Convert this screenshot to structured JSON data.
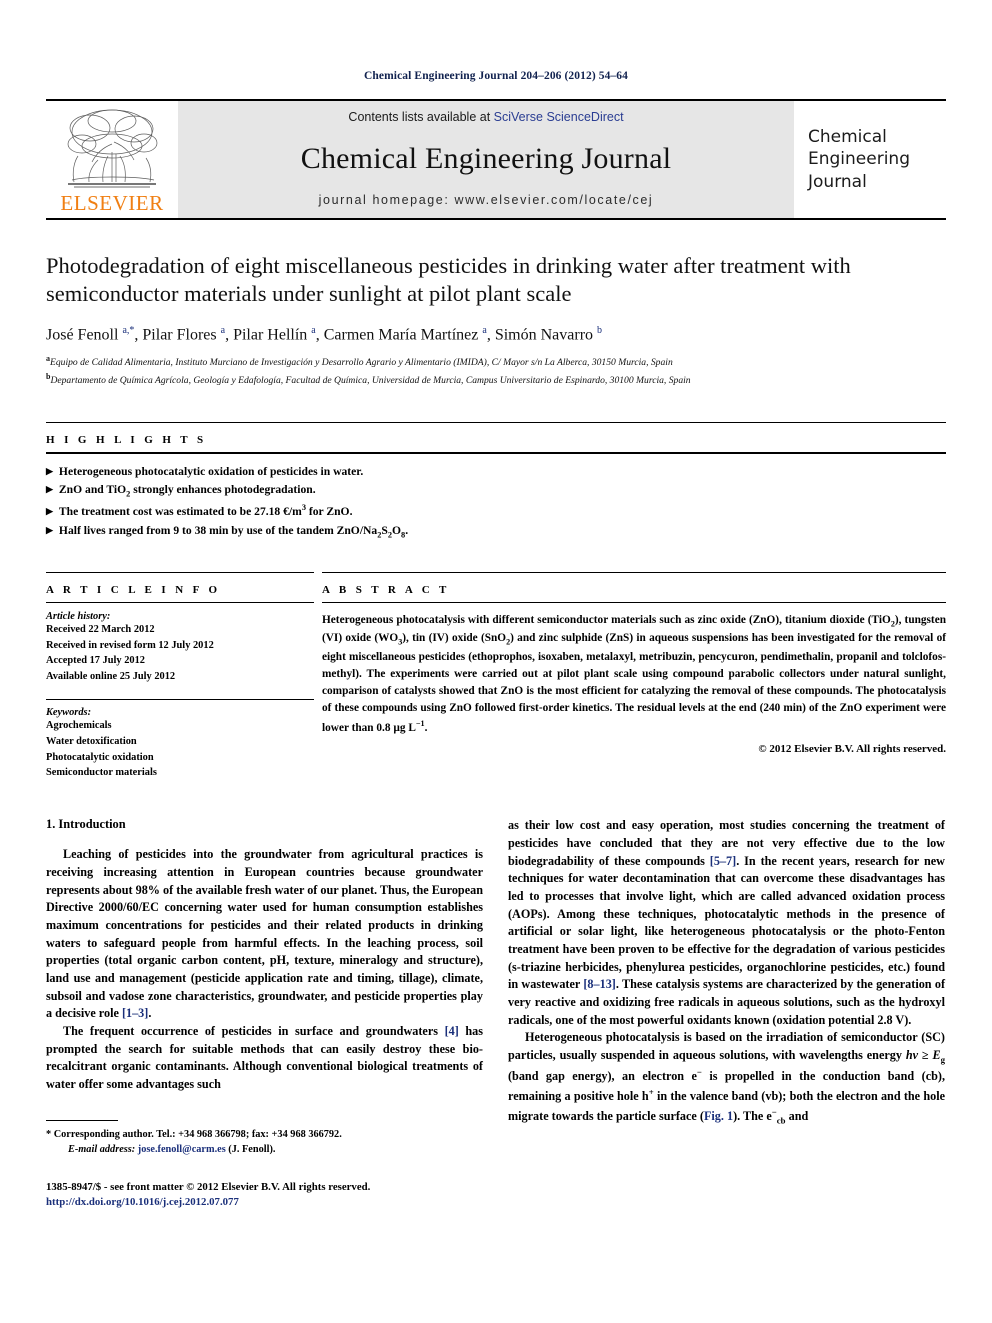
{
  "running_head": "Chemical Engineering Journal 204–206 (2012) 54–64",
  "masthead": {
    "publisher_logo_text": "ELSEVIER",
    "contents_prefix": "Contents lists available at ",
    "contents_link": "SciVerse ScienceDirect",
    "journal_title": "Chemical Engineering Journal",
    "homepage_label": "journal homepage: www.elsevier.com/locate/cej",
    "cover_line1": "Chemical",
    "cover_line2": "Engineering",
    "cover_line3": "Journal",
    "accent_orange": "#f07f13",
    "link_blue": "#2a3d92",
    "panel_grey": "#e6e6e6"
  },
  "article": {
    "title": "Photodegradation of eight miscellaneous pesticides in drinking water after treatment with semiconductor materials under sunlight at pilot plant scale",
    "authors_html": "José Fenoll <sup>a,*</sup>, Pilar Flores <sup>a</sup>, Pilar Hellín <sup>a</sup>, Carmen María Martínez <sup>a</sup>, Simón Navarro <sup>b</sup>",
    "affiliation_a": "Equipo de Calidad Alimentaria, Instituto Murciano de Investigación y Desarrollo Agrario y Alimentario (IMIDA), C/ Mayor s/n La Alberca, 30150 Murcia, Spain",
    "affiliation_b": "Departamento de Química Agrícola, Geología y Edafología, Facultad de Química, Universidad de Murcia, Campus Universitario de Espinardo, 30100 Murcia, Spain"
  },
  "highlights": {
    "heading": "H I G H L I G H T S",
    "items_html": [
      "Heterogeneous photocatalytic oxidation of pesticides in water.",
      "ZnO and TiO<sub>2</sub> strongly enhances photodegradation.",
      "The treatment cost was estimated to be 27.18 &euro;/m<sup>3</sup> for ZnO.",
      "Half lives ranged from 9 to 38 min by use of the tandem ZnO/Na<sub>2</sub>S<sub>2</sub>O<sub>8</sub>."
    ]
  },
  "article_info": {
    "heading": "A R T I C L E    I N F O",
    "history_label": "Article history:",
    "history": [
      "Received 22 March 2012",
      "Received in revised form 12 July 2012",
      "Accepted 17 July 2012",
      "Available online 25 July 2012"
    ],
    "keywords_label": "Keywords:",
    "keywords": [
      "Agrochemicals",
      "Water detoxification",
      "Photocatalytic oxidation",
      "Semiconductor materials"
    ]
  },
  "abstract": {
    "heading": "A B S T R A C T",
    "body_html": "Heterogeneous photocatalysis with different semiconductor materials such as zinc oxide (ZnO), titanium dioxide (TiO<sub>2</sub>), tungsten (VI) oxide (WO<sub>3</sub>), tin (IV) oxide (SnO<sub>2</sub>) and zinc sulphide (ZnS) in aqueous suspensions has been investigated for the removal of eight miscellaneous pesticides (ethoprophos, isoxaben, metalaxyl, metribuzin, pencycuron, pendimethalin, propanil and tolclofos-methyl). The experiments were carried out at pilot plant scale using compound parabolic collectors under natural sunlight, comparison of catalysts showed that ZnO is the most efficient for catalyzing the removal of these compounds. The photocatalysis of these compounds using ZnO followed first-order kinetics. The residual levels at the end (240 min) of the ZnO experiment were lower than 0.8 &micro;g L<sup>&minus;1</sup>.",
    "copyright": "&copy; 2012 Elsevier B.V. All rights reserved."
  },
  "introduction": {
    "heading": "1. Introduction",
    "left_paragraphs_html": [
      "Leaching of pesticides into the groundwater from agricultural practices is receiving increasing attention in European countries because groundwater represents about 98% of the available fresh water of our planet. Thus, the European Directive 2000/60/EC concerning water used for human consumption establishes maximum concentrations for pesticides and their related products in drinking waters to safeguard people from harmful effects. In the leaching process, soil properties (total organic carbon content, pH, texture, mineralogy and structure), land use and management (pesticide application rate and timing, tillage), climate, subsoil and vadose zone characteristics, groundwater, and pesticide properties play a decisive role <span class=\"ref\">[1&ndash;3]</span>.",
      "The frequent occurrence of pesticides in surface and groundwaters <span class=\"ref\">[4]</span> has prompted the search for suitable methods that can easily destroy these bio-recalcitrant organic contaminants. Although conventional biological treatments of water offer some advantages such"
    ],
    "right_paragraphs_html": [
      "as their low cost and easy operation, most studies concerning the treatment of pesticides have concluded that they are not very effective due to the low biodegradability of these compounds <span class=\"ref\">[5&ndash;7]</span>. In the recent years, research for new techniques for water decontamination that can overcome these disadvantages has led to processes that involve light, which are called advanced oxidation process (AOPs). Among these techniques, photocatalytic methods in the presence of artificial or solar light, like heterogeneous photocatalysis or the photo-Fenton treatment have been proven to be effective for the degradation of various pesticides (s-triazine herbicides, phenylurea pesticides, organochlorine pesticides, etc.) found in wastewater <span class=\"ref\">[8&ndash;13]</span>. These catalysis systems are characterized by the generation of very reactive and oxidizing free radicals in aqueous solutions, such as the hydroxyl radicals, one of the most powerful oxidants known (oxidation potential 2.8 V).",
      "Heterogeneous photocatalysis is based on the irradiation of semiconductor (SC) particles, usually suspended in aqueous solutions, with wavelengths energy <i>hv</i> &#8805; <i>E</i><sub>g</sub> (band gap energy), an electron e<sup>&minus;</sup> is propelled in the conduction band (cb), remaining a positive hole h<sup>+</sup> in the valence band (vb); both the electron and the hole migrate towards the particle surface (<span class=\"ref\">Fig. 1</span>). The e<sup>&minus;</sup><sub>cb</sub> and"
    ]
  },
  "footnote": {
    "corresponding_html": "* Corresponding author. Tel.: +34 968 366798; fax: +34 968 366792.",
    "email_html": "<em>E-mail address:</em> <span class=\"fn-mail\">jose.fenoll@carm.es</span> (J. Fenoll).",
    "issn_line": "1385-8947/$ - see front matter © 2012 Elsevier B.V. All rights reserved.",
    "doi_line": "http://dx.doi.org/10.1016/j.cej.2012.07.077"
  }
}
